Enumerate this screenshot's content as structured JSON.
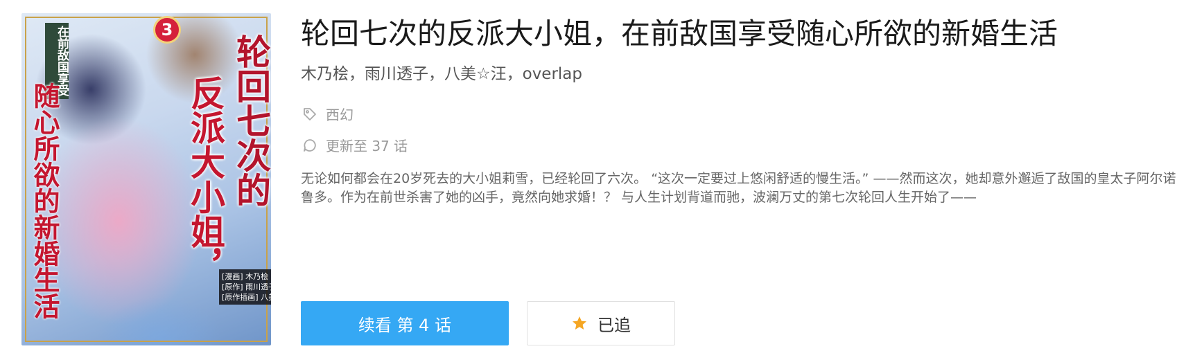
{
  "comic": {
    "title": "轮回七次的反派大小姐，在前敌国享受随心所欲的新婚生活",
    "authors": "木乃桧，雨川透子，八美☆汪，overlap",
    "tag": "西幻",
    "update": "更新至 37 话",
    "description": "无论如何都会在20岁死去的大小姐莉雪，已经轮回了六次。 “这次一定要过上悠闲舒适的慢生活。” ——然而这次，她却意外邂逅了敌国的皇太子阿尔诺鲁多。作为在前世杀害了她的凶手，竟然向她求婚！？ 与人生计划背道而驰，波澜万丈的第七次轮回人生开始了——"
  },
  "cover": {
    "volume": "3",
    "subtitle": "在前敌国享受",
    "left_title": "随心所欲的新婚生活",
    "right_title_1": "轮回七次的",
    "right_title_2": "反派大小姐，",
    "credits": [
      "[漫画] 木乃桧",
      "[原作] 雨川透子",
      "[原作插画] 八美☆汪"
    ]
  },
  "actions": {
    "continue_label": "续看 第 4 话",
    "follow_label": "已追"
  },
  "icons": {
    "tag": "tag-icon",
    "update": "chat-bubble-icon",
    "follow": "star-icon"
  },
  "colors": {
    "primary": "#35a8f4",
    "star": "#f5a623",
    "title_text": "#1a1a1a",
    "muted_text": "#999999"
  }
}
